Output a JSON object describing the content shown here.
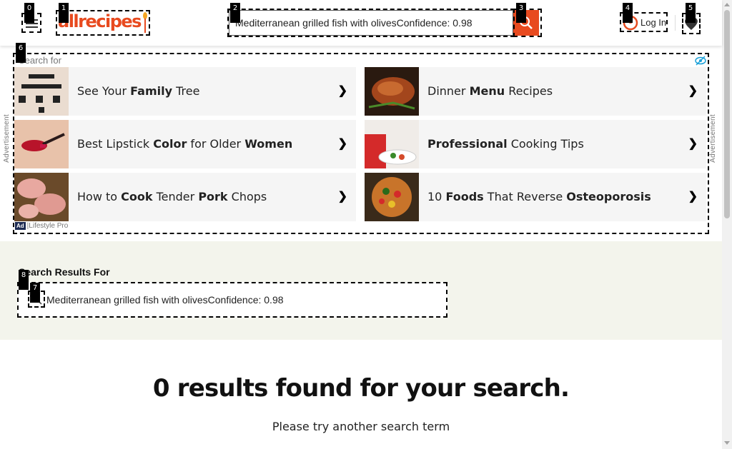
{
  "header": {
    "logo_text": "allrecipes",
    "search_value": "Mediterranean grilled fish with olivesConfidence: 0.98",
    "login_label": "Log In",
    "brand_color": "#e84a1f"
  },
  "markers": [
    "0",
    "1",
    "2",
    "3",
    "4",
    "5",
    "6",
    "7",
    "8"
  ],
  "ad": {
    "search_for": "Search for",
    "side_label": "Advertisement",
    "provider": "Lifestyle Pro",
    "badge": "Ad",
    "items": [
      {
        "pre": "See Your ",
        "b1": "Family",
        "mid": " Tree",
        "b2": "",
        "post": ""
      },
      {
        "pre": "",
        "b1": "",
        "mid": "Dinner ",
        "b2": "Menu",
        "post": " Recipes"
      },
      {
        "pre": "Best Lipstick ",
        "b1": "Color",
        "mid": " for Older ",
        "b2": "Women",
        "post": ""
      },
      {
        "pre": "",
        "b1": "Professional",
        "mid": " Cooking Tips",
        "b2": "",
        "post": ""
      },
      {
        "pre": "How to ",
        "b1": "Cook",
        "mid": " Tender ",
        "b2": "Pork",
        "post": " Chops"
      },
      {
        "pre": "10 ",
        "b1": "Foods",
        "mid": " That Reverse ",
        "b2": "Osteoporosis",
        "post": ""
      }
    ],
    "chevron": "❯"
  },
  "results": {
    "title": "Search Results For",
    "query": "Mediterranean grilled fish with olivesConfidence: 0.98",
    "no_results": "0 results found for your search.",
    "hint": "Please try another search term"
  }
}
